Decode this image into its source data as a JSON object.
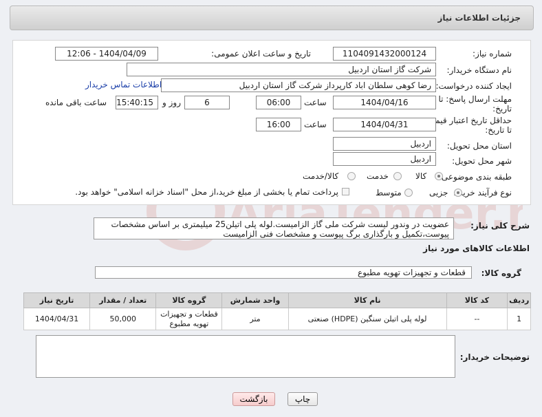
{
  "header": {
    "title": "جزئیات اطلاعات نیاز"
  },
  "form": {
    "need_number": {
      "label": "شماره نیاز:",
      "value": "1104091432000124"
    },
    "announce_datetime": {
      "label": "تاریخ و ساعت اعلان عمومی:",
      "value": "1404/04/09 - 12:06"
    },
    "buyer_org": {
      "label": "نام دستگاه خریدار:",
      "value": "شرکت گاز استان اردبیل"
    },
    "requester": {
      "label": "ایجاد کننده درخواست:",
      "value": "رضا کوهی سلطان اباد کارپرداز شرکت گاز استان اردبیل",
      "contact_link": "اطلاعات تماس خریدار"
    },
    "reply_deadline": {
      "label1": "مهلت ارسال پاسخ: تا",
      "label2": "تاریخ:",
      "date": "1404/04/16",
      "time_label": "ساعت",
      "time": "06:00",
      "days": "6",
      "days_label": "روز و",
      "remaining": "15:40:15",
      "remaining_label": "ساعت باقی مانده"
    },
    "price_validity": {
      "label1": "حداقل تاریخ اعتبار قیمت:",
      "label2": "تا تاریخ:",
      "date": "1404/04/31",
      "time_label": "ساعت",
      "time": "16:00"
    },
    "delivery_province": {
      "label": "استان محل تحویل:",
      "value": "اردبیل"
    },
    "delivery_city": {
      "label": "شهر محل تحویل:",
      "value": "اردبیل"
    },
    "category": {
      "label": "طبقه بندی موضوعی:",
      "options": [
        "کالا",
        "خدمت",
        "کالا/خدمت"
      ],
      "selected": "کالا"
    },
    "process_type": {
      "label": "نوع فرآیند خرید :",
      "options": [
        "جزیی",
        "متوسط"
      ],
      "selected": "جزیی",
      "payment_note": "پرداخت تمام یا بخشی از مبلغ خرید،از محل \"اسناد خزانه اسلامی\" خواهد بود."
    }
  },
  "description": {
    "label": "شرح کلی نیاز:",
    "text": "عضویت در وندور لیست شرکت ملی گاز الزامیست.لوله پلی اتیلن25 میلیمتری بر اساس مشخصات پیوست،تکمیل و بارگذاری برگ پیوست و مشخصات فنی الزامیست"
  },
  "goods": {
    "section_title": "اطلاعات کالاهای مورد نیاز",
    "group_label": "گروه کالا:",
    "group_value": "قطعات و تجهیزات تهویه مطبوع",
    "columns": [
      "ردیف",
      "کد کالا",
      "نام کالا",
      "واحد شمارش",
      "گروه کالا",
      "تعداد / مقدار",
      "تاریخ نیاز"
    ],
    "rows": [
      {
        "row": "1",
        "code": "--",
        "name": "لوله پلی اتیلن سنگین (HDPE) صنعتی",
        "unit": "متر",
        "group": "قطعات و تجهیزات تهویه مطبوع",
        "qty": "50,000",
        "date": "1404/04/31"
      }
    ]
  },
  "buyer_notes": {
    "label": "توضیحات خریدار:",
    "value": ""
  },
  "buttons": {
    "print": "چاپ",
    "back": "بازگشت"
  },
  "watermark": {
    "text": "AriaTender.neT"
  },
  "colors": {
    "link": "#1a3ea8",
    "header_bg": "#d9d9d9",
    "back_button": "#f6cccc",
    "watermark": "#c0392b"
  }
}
